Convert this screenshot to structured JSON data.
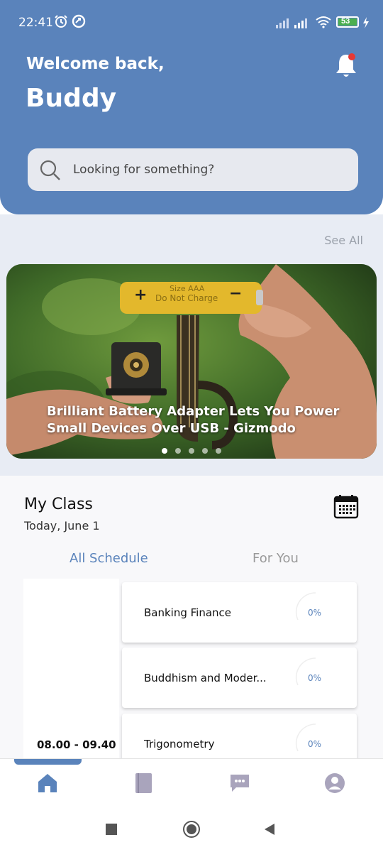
{
  "status_bar": {
    "time": "22:41",
    "battery": "53"
  },
  "header": {
    "greeting": "Welcome back,",
    "user_name": "Buddy"
  },
  "search": {
    "placeholder": "Looking for something?"
  },
  "news": {
    "see_all_label": "See All",
    "banner_caption": "Brilliant Battery Adapter Lets You Power Small Devices Over USB - Gizmodo",
    "battery_plus": "+",
    "battery_minus": "−",
    "battery_text_1": "Size AAA",
    "battery_text_2": "Do Not Charge",
    "dots": 5,
    "active_dot": 1
  },
  "my_class": {
    "title": "My Class",
    "date": "Today, June 1",
    "tabs": [
      {
        "label": "All Schedule"
      },
      {
        "label": "For You"
      }
    ],
    "time_range": "08.00 - 09.40",
    "courses": [
      {
        "title": "Banking Finance",
        "progress": "0%"
      },
      {
        "title": "Buddhism and Moder...",
        "progress": "0%"
      },
      {
        "title": "Trigonometry",
        "progress": "0%"
      }
    ]
  },
  "bottom_nav": [
    {
      "name": "home-icon",
      "active": true
    },
    {
      "name": "book-icon",
      "active": false
    },
    {
      "name": "chat-icon",
      "active": false
    },
    {
      "name": "profile-icon",
      "active": false
    }
  ],
  "colors": {
    "primary": "#5a83bb",
    "inactive": "#a9a4bc",
    "notification": "#e53935"
  }
}
